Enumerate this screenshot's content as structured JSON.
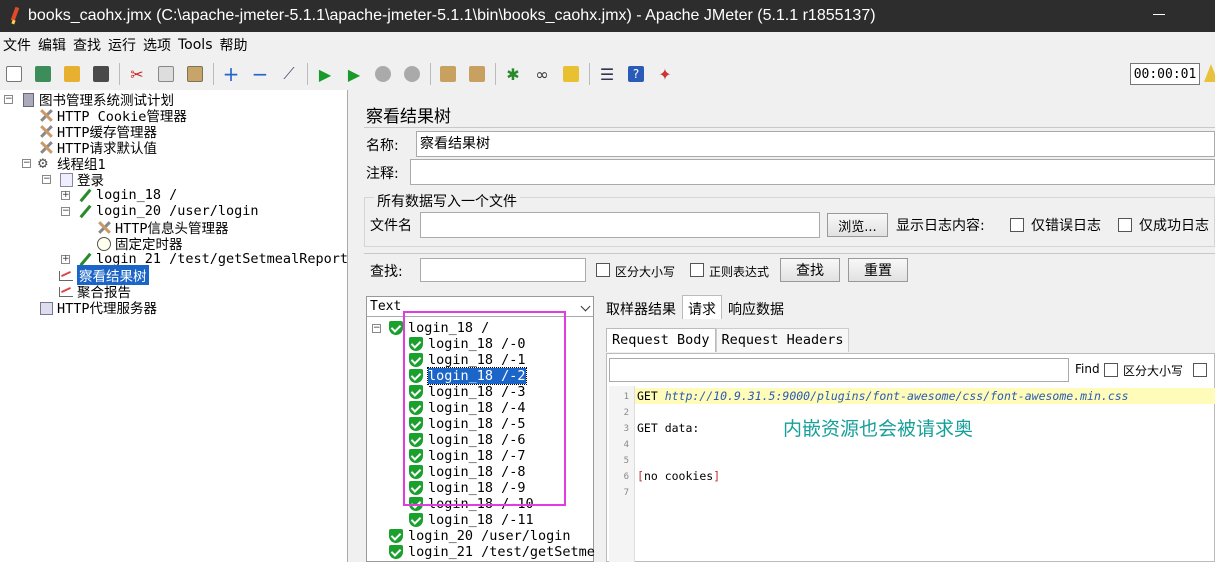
{
  "window": {
    "title": "books_caohx.jmx (C:\\apache-jmeter-5.1.1\\apache-jmeter-5.1.1\\bin\\books_caohx.jmx) - Apache JMeter (5.1.1 r1855137)"
  },
  "menu": [
    "文件",
    "编辑",
    "查找",
    "运行",
    "选项",
    "Tools",
    "帮助"
  ],
  "toolbar": {
    "icons": [
      "new-icon",
      "templates-icon",
      "open-icon",
      "save-icon",
      "cut-icon",
      "copy-icon",
      "paste-icon",
      "expand-icon",
      "collapse-icon",
      "toggle-icon",
      "start-icon",
      "start-no-pause-icon",
      "stop-icon",
      "shutdown-icon",
      "clear-icon",
      "clear-all-icon",
      "search-icon",
      "binoculars-icon",
      "reset-search-icon",
      "function-helper-icon",
      "help-icon",
      "remote-icon"
    ],
    "timer": "00:00:01"
  },
  "tree": {
    "items": [
      {
        "label": "图书管理系统测试计划",
        "icon": "test-plan-icon"
      },
      {
        "label": "HTTP Cookie管理器",
        "icon": "wrench-icon"
      },
      {
        "label": "HTTP缓存管理器",
        "icon": "wrench-icon"
      },
      {
        "label": "HTTP请求默认值",
        "icon": "wrench-icon"
      },
      {
        "label": "线程组1",
        "icon": "gear-icon"
      },
      {
        "label": "登录",
        "icon": "controller-icon"
      },
      {
        "label": "login_18 /",
        "icon": "sampler-icon"
      },
      {
        "label": "login_20 /user/login",
        "icon": "sampler-icon"
      },
      {
        "label": "HTTP信息头管理器",
        "icon": "wrench-icon"
      },
      {
        "label": "固定定时器",
        "icon": "timer-icon"
      },
      {
        "label": "login_21 /test/getSetmealReport",
        "icon": "sampler-icon"
      },
      {
        "label": "察看结果树",
        "icon": "chart-icon"
      },
      {
        "label": "聚合报告",
        "icon": "chart-icon"
      },
      {
        "label": "HTTP代理服务器",
        "icon": "proxy-icon"
      }
    ]
  },
  "panel": {
    "title": "察看结果树",
    "name_label": "名称:",
    "name_value": "察看结果树",
    "comment_label": "注释:",
    "comment_value": "",
    "file_group_title": "所有数据写入一个文件",
    "filename_label": "文件名",
    "filename_value": "",
    "browse_button": "浏览...",
    "log_display_label": "显示日志内容:",
    "errors_only_label": "仅错误日志",
    "success_only_label": "仅成功日志",
    "search_label": "查找:",
    "search_value": "",
    "case_sensitive_label": "区分大小写",
    "regex_label": "正则表达式",
    "search_button": "查找",
    "reset_button": "重置"
  },
  "results": {
    "renderer": "Text",
    "root": "login_18 /",
    "children": [
      "login_18 /-0",
      "login_18 /-1",
      "login_18 /-2",
      "login_18 /-3",
      "login_18 /-4",
      "login_18 /-5",
      "login_18 /-6",
      "login_18 /-7",
      "login_18 /-8",
      "login_18 /-9",
      "login_18 /-10",
      "login_18 /-11"
    ],
    "others": [
      "login_20 /user/login",
      "login_21 /test/getSetme"
    ]
  },
  "tabs": {
    "main": [
      "取样器结果",
      "请求",
      "响应数据"
    ],
    "sub": [
      "Request Body",
      "Request Headers"
    ],
    "find_label": "Find",
    "find_case_label": "区分大小写"
  },
  "request_body": {
    "line_numbers": [
      "1",
      "2",
      "3",
      "4",
      "5",
      "6",
      "7"
    ],
    "line1_method": "GET ",
    "line1_url": "http://10.9.31.5:9000/plugins/font-awesome/css/font-awesome.min.css",
    "line3": "GET data:",
    "line6_open": "[",
    "line6_text": "no cookies",
    "line6_close": "]"
  },
  "annotation": "内嵌资源也会被请求奥"
}
